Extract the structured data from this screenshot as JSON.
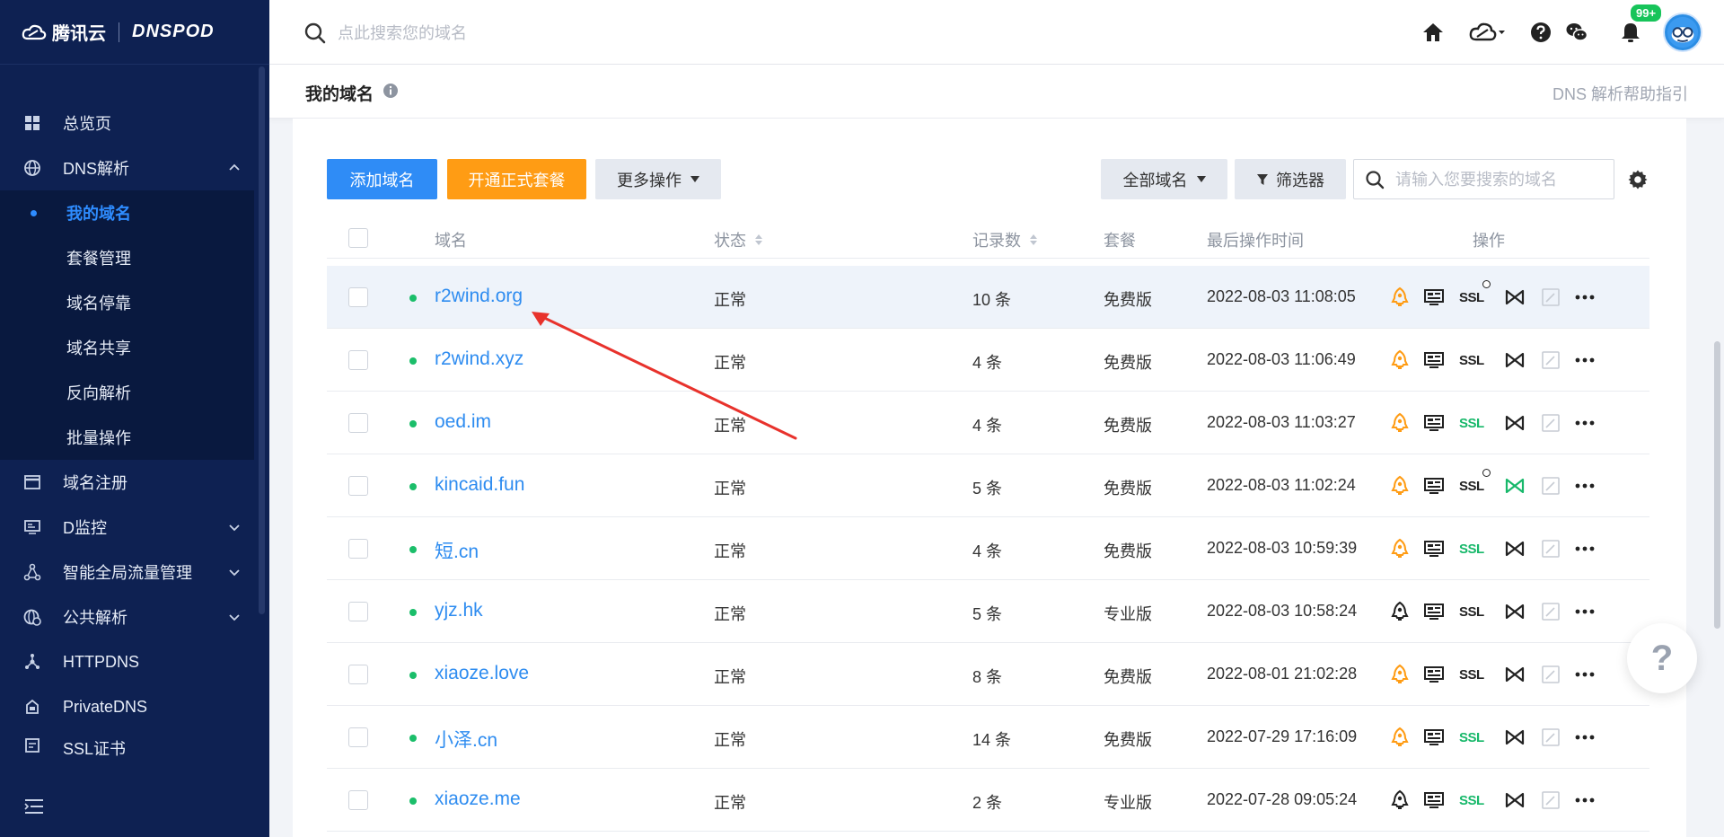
{
  "brand": {
    "name": "腾讯云",
    "sub": "DNSPOD"
  },
  "sidebar": {
    "items": [
      {
        "label": "总览页",
        "icon": "grid-icon"
      },
      {
        "label": "DNS解析",
        "icon": "globe-icon",
        "expanded": true,
        "children": [
          "我的域名",
          "套餐管理",
          "域名停靠",
          "域名共享",
          "反向解析",
          "批量操作"
        ],
        "active_child": "我的域名"
      },
      {
        "label": "域名注册",
        "icon": "window-icon"
      },
      {
        "label": "D监控",
        "icon": "monitor-icon"
      },
      {
        "label": "智能全局流量管理",
        "icon": "nodes-icon"
      },
      {
        "label": "公共解析",
        "icon": "globe-clock-icon"
      },
      {
        "label": "HTTPDNS",
        "icon": "branch-icon"
      },
      {
        "label": "PrivateDNS",
        "icon": "lock-box-icon"
      },
      {
        "label": "SSL证书",
        "icon": "certificate-icon"
      }
    ]
  },
  "topbar": {
    "search_placeholder": "点此搜索您的域名",
    "badge": "99+"
  },
  "page": {
    "title": "我的域名",
    "help_link": "DNS 解析帮助指引"
  },
  "toolbar": {
    "add_domain": "添加域名",
    "open_plan": "开通正式套餐",
    "more_actions": "更多操作",
    "all_domains": "全部域名",
    "filter": "筛选器",
    "search_placeholder": "请输入您要搜索的域名"
  },
  "table": {
    "headers": {
      "domain": "域名",
      "status": "状态",
      "records": "记录数",
      "plan": "套餐",
      "last_op": "最后操作时间",
      "ops": "操作"
    },
    "ssl_label": "SSL",
    "rows": [
      {
        "domain": "r2wind.org",
        "status": "正常",
        "records": "10 条",
        "plan": "免费版",
        "time": "2022-08-03 11:08:05",
        "rocket": "orange",
        "ssl_color": "#222222",
        "ssl_clock": true,
        "link_color": "#222222"
      },
      {
        "domain": "r2wind.xyz",
        "status": "正常",
        "records": "4 条",
        "plan": "免费版",
        "time": "2022-08-03 11:06:49",
        "rocket": "orange",
        "ssl_color": "#222222",
        "ssl_clock": false,
        "link_color": "#222222"
      },
      {
        "domain": "oed.im",
        "status": "正常",
        "records": "4 条",
        "plan": "免费版",
        "time": "2022-08-03 11:03:27",
        "rocket": "orange",
        "ssl_color": "#17b86a",
        "ssl_clock": false,
        "link_color": "#222222"
      },
      {
        "domain": "kincaid.fun",
        "status": "正常",
        "records": "5 条",
        "plan": "免费版",
        "time": "2022-08-03 11:02:24",
        "rocket": "orange",
        "ssl_color": "#222222",
        "ssl_clock": true,
        "link_color": "#17b86a"
      },
      {
        "domain": "短.cn",
        "status": "正常",
        "records": "4 条",
        "plan": "免费版",
        "time": "2022-08-03 10:59:39",
        "rocket": "orange",
        "ssl_color": "#17b86a",
        "ssl_clock": false,
        "link_color": "#222222"
      },
      {
        "domain": "yjz.hk",
        "status": "正常",
        "records": "5 条",
        "plan": "专业版",
        "time": "2022-08-03 10:58:24",
        "rocket": "dark",
        "ssl_color": "#222222",
        "ssl_clock": false,
        "link_color": "#222222"
      },
      {
        "domain": "xiaoze.love",
        "status": "正常",
        "records": "8 条",
        "plan": "免费版",
        "time": "2022-08-01 21:02:28",
        "rocket": "orange",
        "ssl_color": "#222222",
        "ssl_clock": false,
        "link_color": "#222222"
      },
      {
        "domain": "小泽.cn",
        "status": "正常",
        "records": "14 条",
        "plan": "免费版",
        "time": "2022-07-29 17:16:09",
        "rocket": "orange",
        "ssl_color": "#17b86a",
        "ssl_clock": false,
        "link_color": "#222222"
      },
      {
        "domain": "xiaoze.me",
        "status": "正常",
        "records": "2 条",
        "plan": "专业版",
        "time": "2022-07-28 09:05:24",
        "rocket": "dark",
        "ssl_color": "#17b86a",
        "ssl_clock": false,
        "link_color": "#222222"
      }
    ]
  },
  "colors": {
    "sidebar_bg": "#0e2152",
    "accent": "#2e8cf0",
    "orange": "#ff9c14",
    "green": "#17b86a",
    "annotation": "#e8322c"
  }
}
